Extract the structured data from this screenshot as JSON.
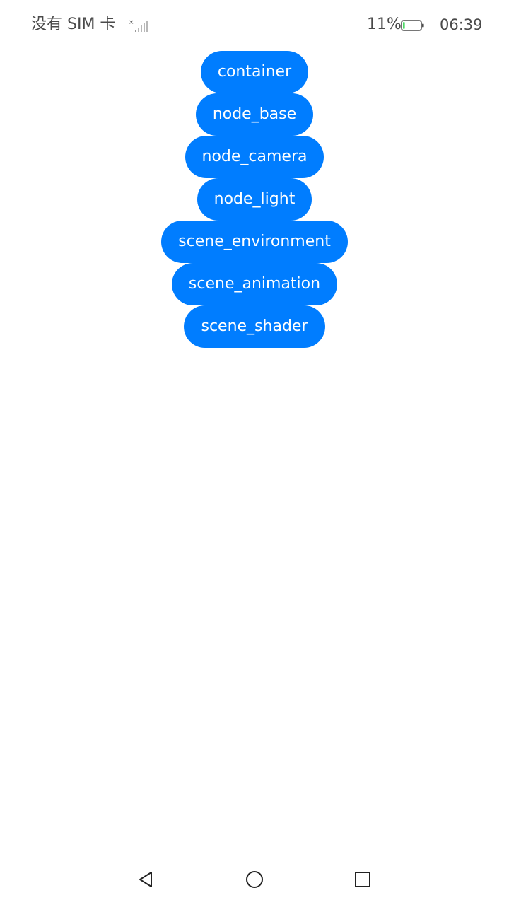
{
  "status_bar": {
    "carrier": "没有 SIM 卡",
    "signal_icon": "no-signal-icon",
    "battery_percent": "11%",
    "battery_level": 0.11,
    "battery_icon": "battery-charging-icon",
    "time": "06:39"
  },
  "buttons": [
    {
      "label": "container"
    },
    {
      "label": "node_base"
    },
    {
      "label": "node_camera"
    },
    {
      "label": "node_light"
    },
    {
      "label": "scene_environment"
    },
    {
      "label": "scene_animation"
    },
    {
      "label": "scene_shader"
    }
  ],
  "nav_bar": {
    "back_icon": "back-triangle-icon",
    "home_icon": "home-circle-icon",
    "recent_icon": "recent-apps-square-icon"
  },
  "colors": {
    "accent": "#007dff",
    "button_text": "#ffffff",
    "status_text": "#4a4a4a",
    "battery_fill": "#4cd964",
    "background": "#ffffff"
  }
}
